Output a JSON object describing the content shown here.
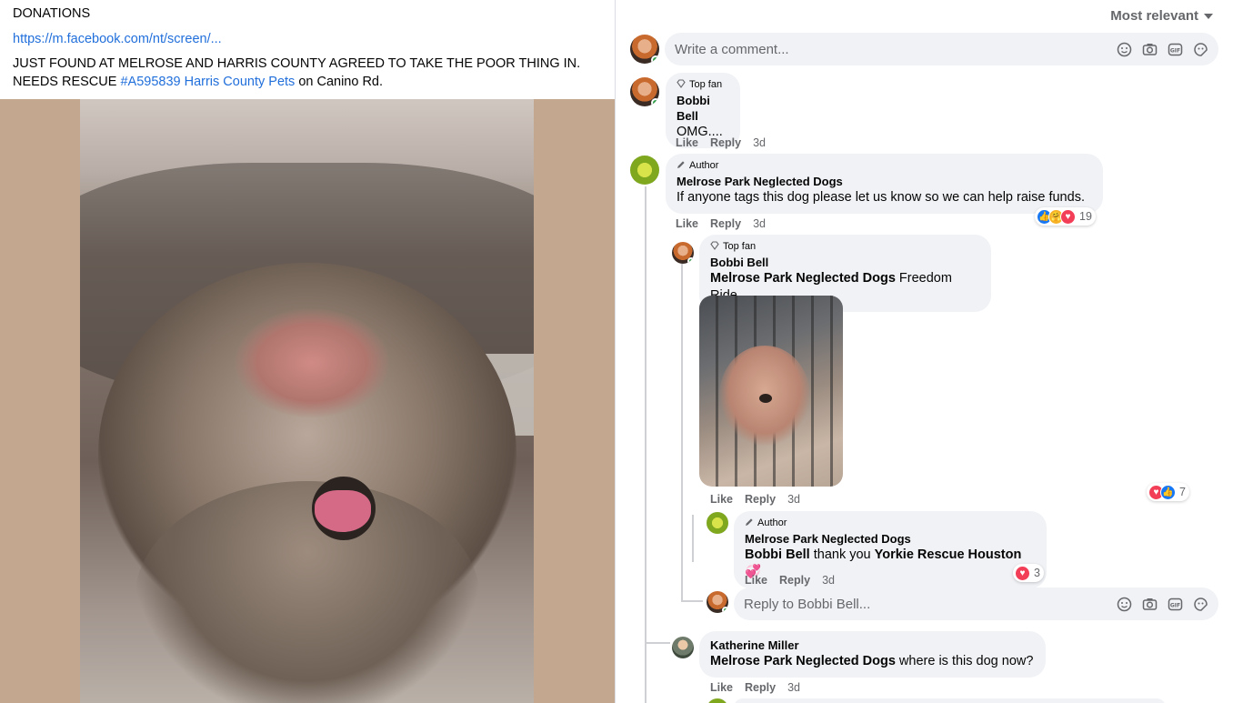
{
  "post": {
    "line1": "DONATIONS",
    "link": "https://m.facebook.com/nt/screen/...",
    "body_pre": "JUST FOUND AT MELROSE AND HARRIS COUNTY AGREED TO TAKE THE POOR THING IN. NEEDS RESCUE ",
    "hashtag": "#A595839",
    "mention": "Harris County Pets",
    "body_post": " on Canino Rd."
  },
  "sort": {
    "label": "Most relevant"
  },
  "composer": {
    "placeholder": "Write a comment..."
  },
  "comments": [
    {
      "badge": "Top fan",
      "author": "Bobbi Bell",
      "text": "OMG....",
      "like": "Like",
      "reply": "Reply",
      "time": "3d"
    },
    {
      "badge": "Author",
      "author": "Melrose Park Neglected Dogs",
      "text": "If anyone tags this dog please let us know so we can help raise funds.",
      "like": "Like",
      "reply": "Reply",
      "time": "3d",
      "reaction_count": "19",
      "replies": [
        {
          "badge": "Top fan",
          "author": "Bobbi Bell",
          "tag": "Melrose Park Neglected Dogs",
          "text": " Freedom Ride",
          "like": "Like",
          "reply": "Reply",
          "time": "3d",
          "reaction_count": "7"
        },
        {
          "badge": "Author",
          "author": "Melrose Park Neglected Dogs",
          "tag1": "Bobbi Bell",
          "text_mid": " thank you ",
          "tag2": "Yorkie Rescue Houston",
          "emoji": "💞",
          "like": "Like",
          "reply": "Reply",
          "time": "3d",
          "reaction_count": "3"
        }
      ],
      "reply_placeholder": "Reply to Bobbi Bell..."
    },
    {
      "author": "Katherine Miller",
      "tag": "Melrose Park Neglected Dogs",
      "text": " where is this dog now?",
      "like": "Like",
      "reply": "Reply",
      "time": "3d"
    }
  ],
  "colors": {
    "link": "#216fdb",
    "bubble": "#f0f2f5",
    "online": "#31a24c",
    "like": "#1877f2",
    "love": "#f33e58",
    "care": "#f7b125"
  },
  "icons": [
    "emoji-icon",
    "camera-icon",
    "gif-icon",
    "sticker-icon",
    "diamond-icon",
    "pencil-icon",
    "caret-down-icon"
  ]
}
